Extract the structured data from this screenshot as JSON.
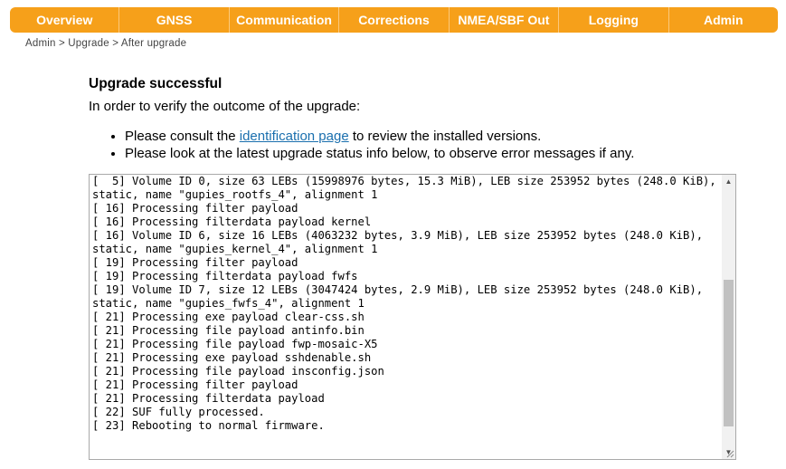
{
  "nav": {
    "tabs": [
      {
        "label": "Overview"
      },
      {
        "label": "GNSS"
      },
      {
        "label": "Communication"
      },
      {
        "label": "Corrections"
      },
      {
        "label": "NMEA/SBF Out"
      },
      {
        "label": "Logging"
      },
      {
        "label": "Admin"
      }
    ],
    "color": "#f6a01a"
  },
  "breadcrumb": "Admin > Upgrade > After upgrade",
  "main": {
    "title": "Upgrade successful",
    "intro": "In order to verify the outcome of the upgrade:",
    "bullet1_prefix": "Please consult the ",
    "bullet1_link": "identification page",
    "bullet1_suffix": " to review the installed versions.",
    "bullet2": "Please look at the latest upgrade status info below, to observe error messages if any."
  },
  "log": {
    "text": "[  5] Volume ID 0, size 63 LEBs (15998976 bytes, 15.3 MiB), LEB size 253952 bytes (248.0 KiB), static, name \"gupies_rootfs_4\", alignment 1\n[ 16] Processing filter payload\n[ 16] Processing filterdata payload kernel\n[ 16] Volume ID 6, size 16 LEBs (4063232 bytes, 3.9 MiB), LEB size 253952 bytes (248.0 KiB), static, name \"gupies_kernel_4\", alignment 1\n[ 19] Processing filter payload\n[ 19] Processing filterdata payload fwfs\n[ 19] Volume ID 7, size 12 LEBs (3047424 bytes, 2.9 MiB), LEB size 253952 bytes (248.0 KiB), static, name \"gupies_fwfs_4\", alignment 1\n[ 21] Processing exe payload clear-css.sh\n[ 21] Processing file payload antinfo.bin\n[ 21] Processing file payload fwp-mosaic-X5\n[ 21] Processing exe payload sshdenable.sh\n[ 21] Processing file payload insconfig.json\n[ 21] Processing filter payload\n[ 21] Processing filterdata payload\n[ 22] SUF fully processed.\n[ 23] Rebooting to normal firmware."
  }
}
